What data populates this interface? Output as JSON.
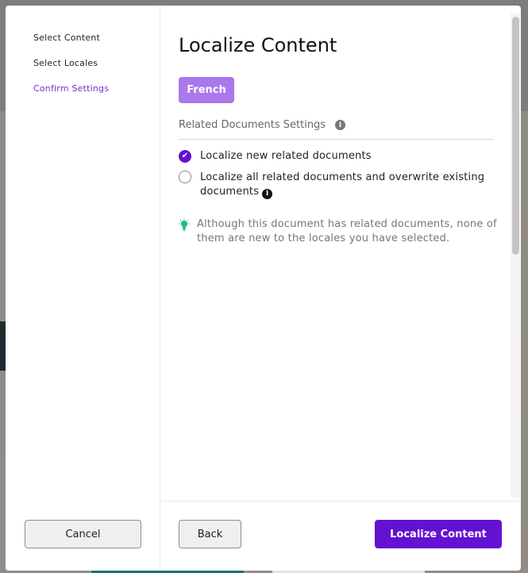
{
  "steps": [
    {
      "label": "Select Content"
    },
    {
      "label": "Select Locales"
    },
    {
      "label": "Confirm Settings"
    }
  ],
  "main": {
    "title": "Localize Content",
    "locale_chip": "French",
    "section_label": "Related Documents Settings",
    "options": [
      {
        "label": "Localize new related documents",
        "selected": true
      },
      {
        "label": "Localize all related documents and overwrite existing documents",
        "selected": false
      }
    ],
    "hint": "Although this document has related documents, none of them are new to the locales you have selected."
  },
  "footer": {
    "cancel_label": "Cancel",
    "back_label": "Back",
    "submit_label": "Localize Content"
  },
  "icons": {
    "info": "info-icon",
    "check": "check-icon",
    "hint": "lightbulb-icon"
  },
  "colors": {
    "accent": "#6411d1",
    "chip": "#a978ea",
    "hint_icon": "#1fb89a"
  }
}
